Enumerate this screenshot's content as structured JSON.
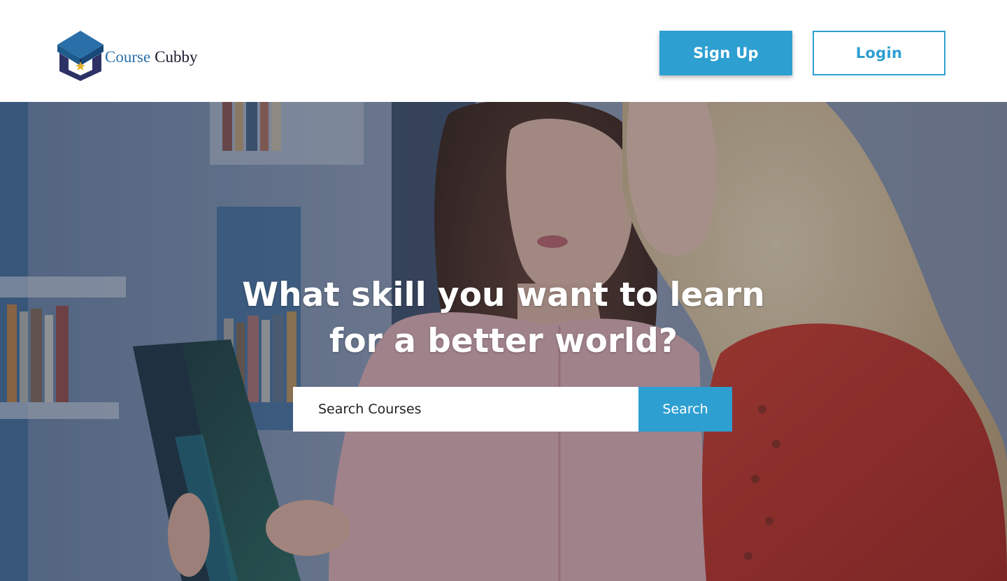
{
  "brand": {
    "name_part1": "Course",
    "name_part2": "Cubby",
    "colors": {
      "cap": "#2a6fa8",
      "frame": "#2d3166",
      "tassel": "#e6b022"
    }
  },
  "header": {
    "signup_label": "Sign Up",
    "login_label": "Login",
    "accent_color": "#2e9fd1"
  },
  "hero": {
    "heading_line1": "What skill you want to learn",
    "heading_line2": "for a better world?",
    "search": {
      "placeholder": "Search Courses",
      "value": "",
      "button_label": "Search"
    },
    "image_subject": "two young women reading a book together in a library"
  }
}
